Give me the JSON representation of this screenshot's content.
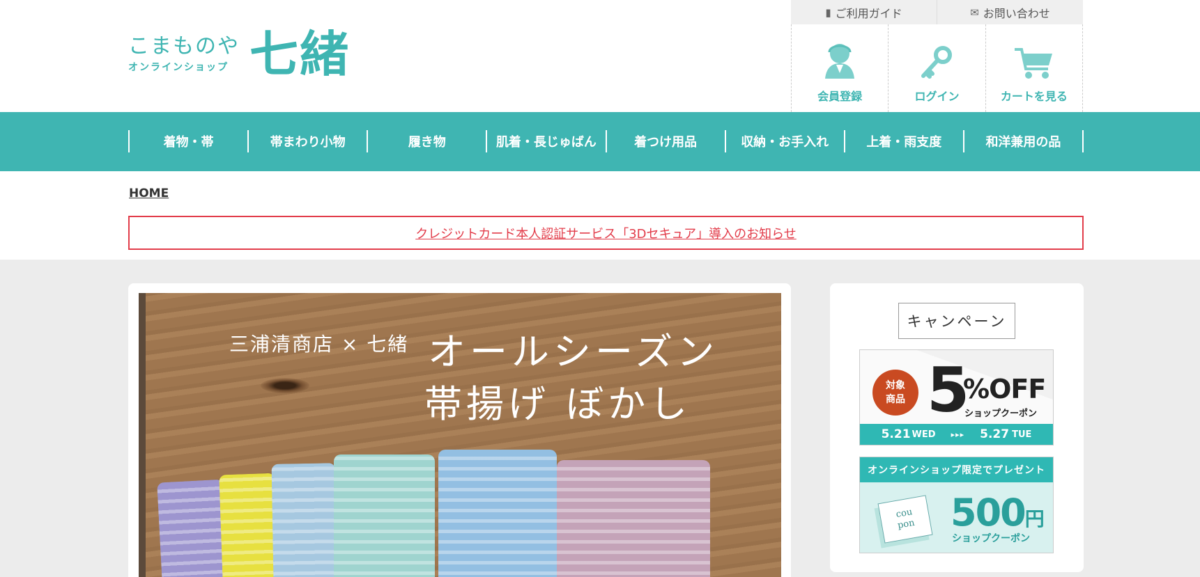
{
  "logo": {
    "main": "こまものや",
    "sub": "オンラインショップ",
    "name": "七緒"
  },
  "util": {
    "guide": "ご利用ガイド",
    "contact": "お問い合わせ",
    "register": "会員登録",
    "login": "ログイン",
    "cart": "カートを見る"
  },
  "nav": [
    "着物・帯",
    "帯まわり小物",
    "履き物",
    "肌着・長じゅばん",
    "着つけ用品",
    "収納・お手入れ",
    "上着・雨支度",
    "和洋兼用の品"
  ],
  "breadcrumb": "HOME",
  "notice": "クレジットカード本人認証サービス「3Dセキュア」導入のお知らせ",
  "banner": {
    "subtitle": "三浦清商店 × 七緒",
    "title1": "オールシーズン",
    "title2": "帯揚げ ぼかし"
  },
  "campaign": {
    "heading": "キャンペーン",
    "coupon1": {
      "badge_line1": "対象",
      "badge_line2": "商品",
      "number": "5",
      "off": "%OFF",
      "label": "ショップクーポン",
      "start": "5.21",
      "start_day": "WED",
      "arrow": "▸▸▸",
      "end": "5.27",
      "end_day": "TUE"
    },
    "coupon2": {
      "header": "オンラインショップ限定でプレゼント",
      "card_line1": "cou",
      "card_line2": "pon",
      "amount": "500",
      "unit": "円",
      "label": "ショップクーポン"
    }
  },
  "colors": {
    "teal": "#3fb5b2",
    "notice_red": "#e23c4a",
    "badge": "#c94a21"
  }
}
